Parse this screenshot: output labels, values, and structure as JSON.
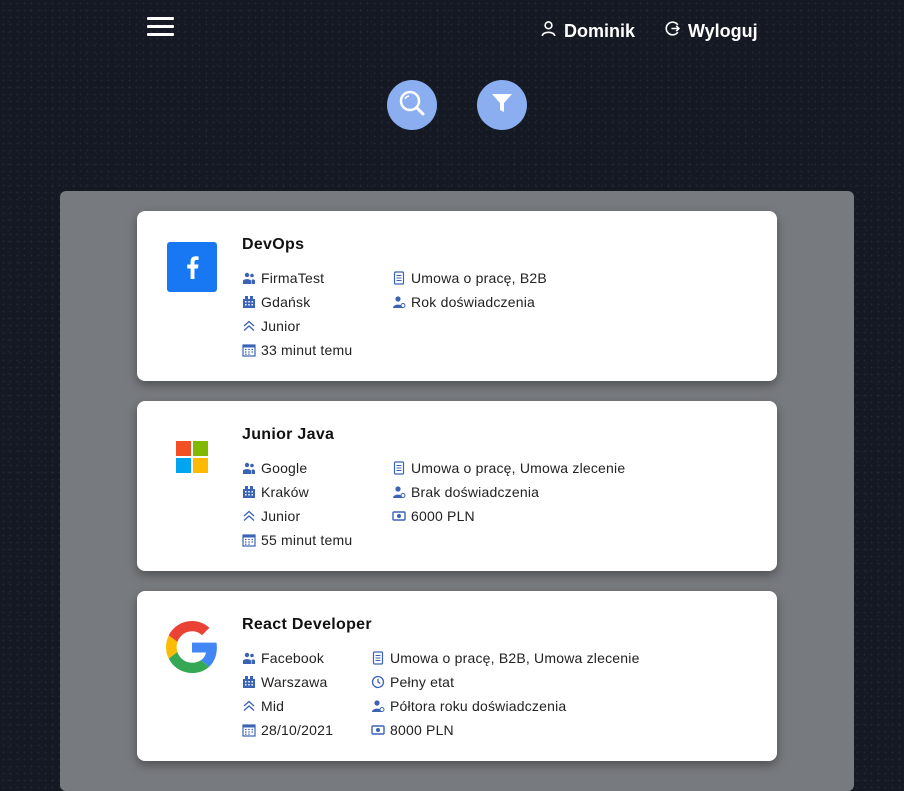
{
  "header": {
    "user_name": "Dominik",
    "logout_label": "Wyloguj"
  },
  "colors": {
    "accent": "#8aaef0",
    "icon_blue": "#3b63b5",
    "panel": "#777a7e"
  },
  "offers": [
    {
      "title": "DevOps",
      "logo": "facebook-logo",
      "company": "FirmaTest",
      "city": "Gdańsk",
      "level": "Junior",
      "posted": "33 minut temu",
      "contract": "Umowa o pracę, B2B",
      "experience": "Rok doświadczenia"
    },
    {
      "title": "Junior Java",
      "logo": "microsoft-logo",
      "company": "Google",
      "city": "Kraków",
      "level": "Junior",
      "posted": "55 minut temu",
      "contract": "Umowa o pracę, Umowa zlecenie",
      "experience": "Brak doświadczenia",
      "salary": "6000 PLN"
    },
    {
      "title": "React Developer",
      "logo": "google-logo",
      "company": "Facebook",
      "city": "Warszawa",
      "level": "Mid",
      "posted": "28/10/2021",
      "contract": "Umowa o pracę, B2B, Umowa zlecenie",
      "worktime": "Pełny etat",
      "experience": "Półtora roku doświadczenia",
      "salary": "8000 PLN"
    }
  ]
}
